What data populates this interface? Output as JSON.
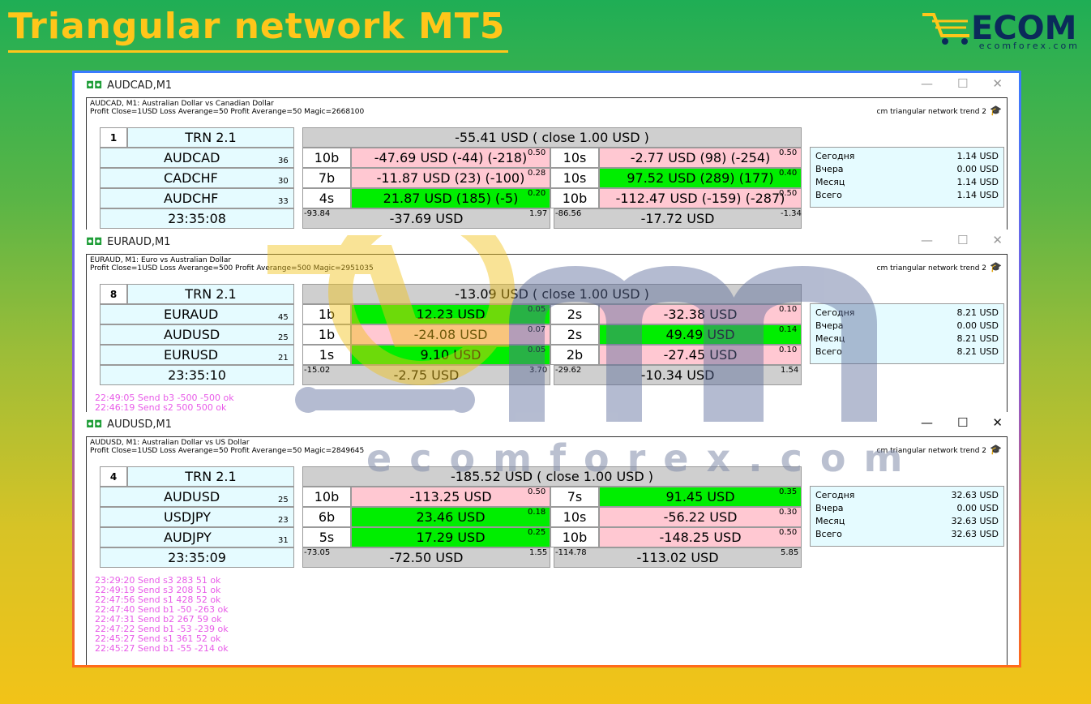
{
  "page_title": "Triangular network MT5",
  "logo": {
    "brand": "ECOM",
    "domain": "ecomforex.com"
  },
  "watermark": "ecomforex.com",
  "stats_labels": [
    "Сегодня",
    "Вчера",
    "Месяц",
    "Всего"
  ],
  "windows": [
    {
      "title": "AUDCAD,M1",
      "info1": "AUDCAD, M1:  Australian Dollar vs Canadian Dollar",
      "info2": "Profit Close=1USD Loss Averange=50 Profit Averange=50 Magic=2668100",
      "ea": "cm triangular network trend 2",
      "num": "1",
      "trn": "TRN 2.1",
      "header": "-55.41 USD   ( close 1.00 USD )",
      "rows": [
        {
          "sym": "AUDCAD",
          "n": "36",
          "lt": "10b",
          "lv": "-47.69 USD (-44) (-218)",
          "ls": "0.50",
          "lc": "pk",
          "rt": "10s",
          "rv": "-2.77 USD (98) (-254)",
          "rs": "0.50",
          "rc": "pk"
        },
        {
          "sym": "CADCHF",
          "n": "30",
          "lt": "7b",
          "lv": "-11.87 USD (23) (-100)",
          "ls": "0.28",
          "lc": "pk",
          "rt": "10s",
          "rv": "97.52 USD (289) (177)",
          "rs": "0.40",
          "rc": "gr"
        },
        {
          "sym": "AUDCHF",
          "n": "33",
          "lt": "4s",
          "lv": "21.87 USD (185) (-5)",
          "ls": "0.20",
          "lc": "gr",
          "rt": "10b",
          "rv": "-112.47 USD (-159) (-287)",
          "rs": "0.50",
          "rc": "pk"
        }
      ],
      "time": "23:35:08",
      "f_l1": "-93.84",
      "f_lv": "-37.69 USD",
      "f_l2": "1.97",
      "f_r1": "-86.56",
      "f_rv": "-17.72 USD",
      "f_r2": "-1.34",
      "stats": [
        "1.14 USD",
        "0.00 USD",
        "1.14 USD",
        "1.14 USD"
      ],
      "log": []
    },
    {
      "title": "EURAUD,M1",
      "info1": "EURAUD, M1:  Euro vs Australian Dollar",
      "info2": "Profit Close=1USD Loss Averange=500 Profit Averange=500 Magic=2951035",
      "ea": "cm triangular network trend 2",
      "num": "8",
      "trn": "TRN 2.1",
      "header": "-13.09 USD   ( close 1.00 USD )",
      "rows": [
        {
          "sym": "EURAUD",
          "n": "45",
          "lt": "1b",
          "lv": "12.23 USD",
          "ls": "0.05",
          "lc": "gr",
          "rt": "2s",
          "rv": "-32.38 USD",
          "rs": "0.10",
          "rc": "pk"
        },
        {
          "sym": "AUDUSD",
          "n": "25",
          "lt": "1b",
          "lv": "-24.08 USD",
          "ls": "0.07",
          "lc": "pk",
          "rt": "2s",
          "rv": "49.49 USD",
          "rs": "0.14",
          "rc": "gr"
        },
        {
          "sym": "EURUSD",
          "n": "21",
          "lt": "1s",
          "lv": "9.10 USD",
          "ls": "0.05",
          "lc": "gr",
          "rt": "2b",
          "rv": "-27.45 USD",
          "rs": "0.10",
          "rc": "pk"
        }
      ],
      "time": "23:35:10",
      "f_l1": "-15.02",
      "f_lv": "-2.75 USD",
      "f_l2": "3.70",
      "f_r1": "-29.62",
      "f_rv": "-10.34 USD",
      "f_r2": "1.54",
      "stats": [
        "8.21 USD",
        "0.00 USD",
        "8.21 USD",
        "8.21 USD"
      ],
      "log": [
        "22:49:05 Send b3 -500 -500 ok",
        "22:46:19 Send s2 500 500 ok"
      ]
    },
    {
      "title": "AUDUSD,M1",
      "info1": "AUDUSD, M1:  Australian Dollar vs US Dollar",
      "info2": "Profit Close=1USD Loss Averange=50 Profit Averange=50 Magic=2849645",
      "ea": "cm triangular network trend 2",
      "num": "4",
      "trn": "TRN 2.1",
      "header": "-185.52 USD   ( close 1.00 USD )",
      "rows": [
        {
          "sym": "AUDUSD",
          "n": "25",
          "lt": "10b",
          "lv": "-113.25 USD",
          "ls": "0.50",
          "lc": "pk",
          "rt": "7s",
          "rv": "91.45 USD",
          "rs": "0.35",
          "rc": "gr"
        },
        {
          "sym": "USDJPY",
          "n": "23",
          "lt": "6b",
          "lv": "23.46 USD",
          "ls": "0.18",
          "lc": "gr",
          "rt": "10s",
          "rv": "-56.22 USD",
          "rs": "0.30",
          "rc": "pk"
        },
        {
          "sym": "AUDJPY",
          "n": "31",
          "lt": "5s",
          "lv": "17.29 USD",
          "ls": "0.25",
          "lc": "gr",
          "rt": "10b",
          "rv": "-148.25 USD",
          "rs": "0.50",
          "rc": "pk"
        }
      ],
      "time": "23:35:09",
      "f_l1": "-73.05",
      "f_lv": "-72.50 USD",
      "f_l2": "1.55",
      "f_r1": "-114.78",
      "f_rv": "-113.02 USD",
      "f_r2": "5.85",
      "stats": [
        "32.63 USD",
        "0.00 USD",
        "32.63 USD",
        "32.63 USD"
      ],
      "log": [
        "23:29:20 Send s3 283 51 ok",
        "22:49:19 Send s3 208 51 ok",
        "22:47:56 Send s1 428 52 ok",
        "22:47:40 Send b1 -50 -263 ok",
        "22:47:31 Send b2 267 59 ok",
        "22:47:22 Send b1 -53 -239 ok",
        "22:45:27 Send s1 361 52 ok",
        "22:45:27 Send b1 -55 -214 ok"
      ]
    }
  ]
}
